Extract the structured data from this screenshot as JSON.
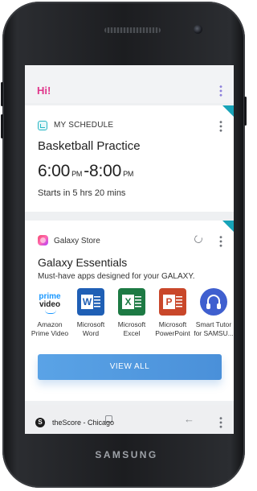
{
  "device": {
    "brand": "SAMSUNG"
  },
  "topbar": {
    "greeting": "Hi!"
  },
  "schedule_card": {
    "header": "MY SCHEDULE",
    "event": "Basketball  Practice",
    "start_time": "6:00",
    "start_ampm": "PM",
    "separator": "-",
    "end_time": "8:00",
    "end_ampm": "PM",
    "starts_in": "Starts in 5 hrs 20 mins"
  },
  "store_card": {
    "store_name": "Galaxy Store",
    "title": "Galaxy Essentials",
    "subtitle": "Must-have apps designed for your GALAXY.",
    "apps": [
      {
        "label_line1": "Amazon",
        "label_line2": "Prime Video",
        "icon": "prime-video-icon",
        "icon_text1": "prime",
        "icon_text2": "video"
      },
      {
        "label_line1": "Microsoft",
        "label_line2": "Word",
        "icon": "word-icon",
        "icon_letter": "W"
      },
      {
        "label_line1": "Microsoft",
        "label_line2": "Excel",
        "icon": "excel-icon",
        "icon_letter": "X"
      },
      {
        "label_line1": "Microsoft",
        "label_line2": "PowerPoint",
        "icon": "powerpoint-icon",
        "icon_letter": "P"
      },
      {
        "label_line1": "Smart Tutor",
        "label_line2": "for SAMSU...",
        "icon": "headset-icon"
      }
    ],
    "button": "VIEW ALL"
  },
  "toast": {
    "icon_letter": "S",
    "text": "theScore - Chicago"
  },
  "colors": {
    "greeting": "#e0368b",
    "accent_corner": "#17a3b8",
    "button": "#4a90d9"
  }
}
